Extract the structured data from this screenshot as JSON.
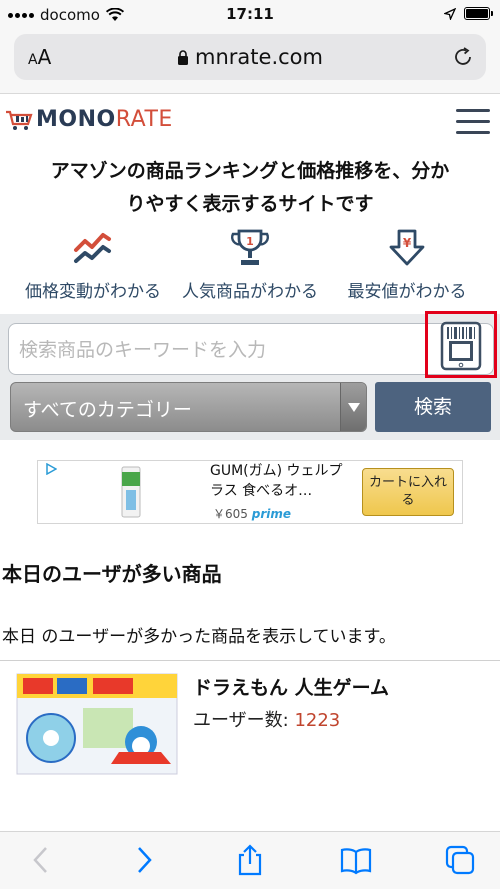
{
  "status_bar": {
    "carrier": "docomo",
    "time": "17:11"
  },
  "browser": {
    "text_size_label_small": "A",
    "text_size_label_large": "A",
    "url": "mnrate.com"
  },
  "site": {
    "logo_mono": "MONO",
    "logo_rate": "RATE",
    "tagline_line1": "アマゾンの商品ランキングと価格推移を、分か",
    "tagline_line2": "りやすく表示するサイトです",
    "features": [
      {
        "icon": "trend-chart-icon",
        "label": "価格変動がわかる"
      },
      {
        "icon": "trophy-icon",
        "label": "人気商品がわかる"
      },
      {
        "icon": "yen-down-arrow-icon",
        "label": "最安値がわかる"
      }
    ]
  },
  "search": {
    "placeholder": "検索商品のキーワードを入力",
    "category_selected": "すべてのカテゴリー",
    "button_label": "検索"
  },
  "ad": {
    "title": "GUM(ガム) ウェルプラス 食べるオ…",
    "price": "￥605",
    "prime_label": "prime",
    "cart_button": "カートに入れる"
  },
  "ranking": {
    "title": "本日のユーザが多い商品",
    "description": "本日 のユーザーが多かった商品を表示しています。",
    "items": [
      {
        "name": "ドラえもん 人生ゲーム",
        "users_label": "ユーザー数:",
        "users_count": "1223"
      }
    ]
  },
  "colors": {
    "accent_red": "#e2001a",
    "search_button": "#4d637f",
    "logo_navy": "#2a3b55",
    "logo_red": "#d34e3a",
    "ios_blue": "#007aff"
  }
}
